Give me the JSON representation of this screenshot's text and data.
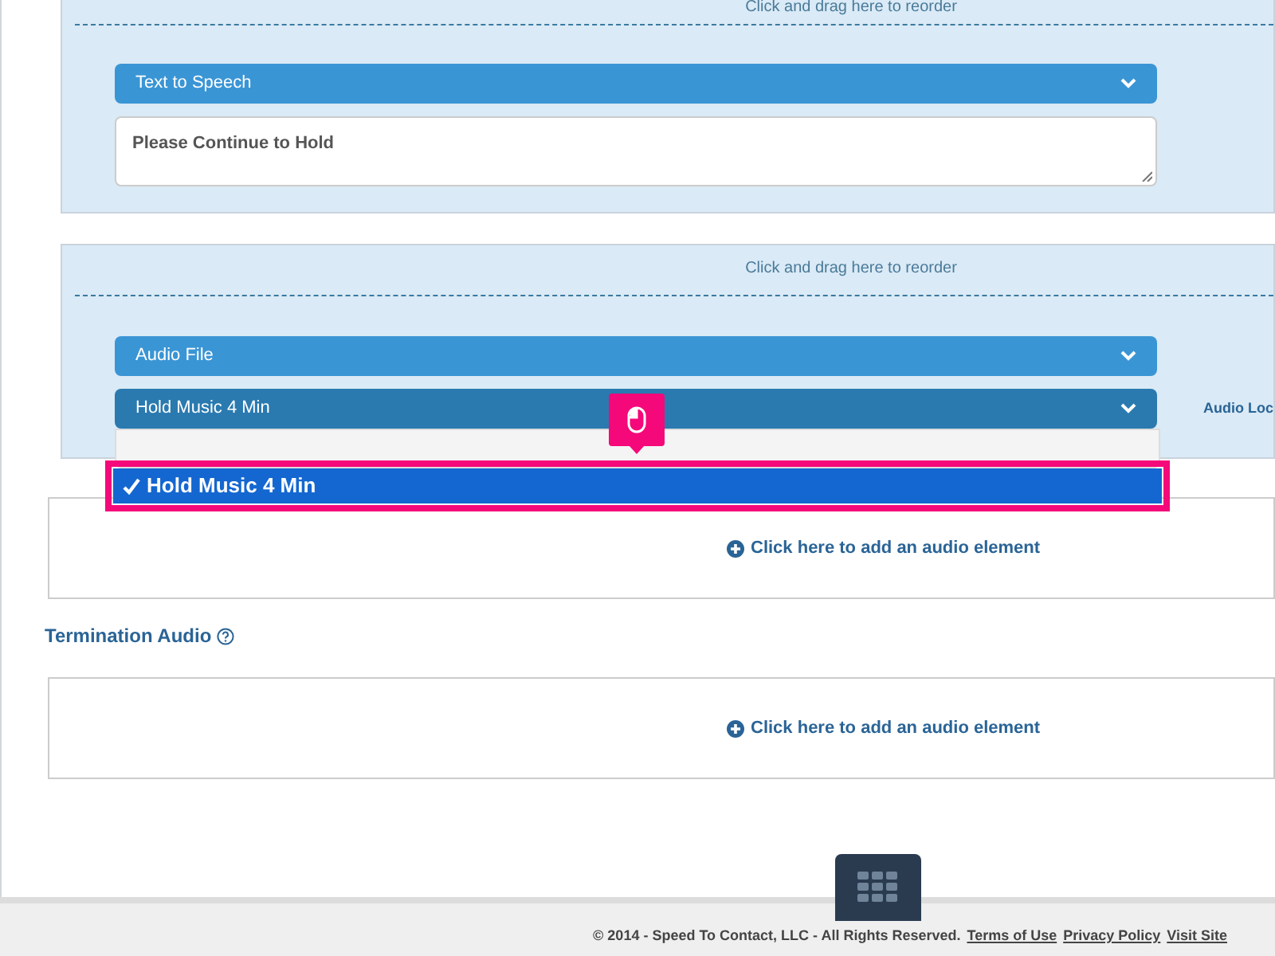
{
  "audio_elements": [
    {
      "drag_hint": "Click and drag here to reorder",
      "type_select": "Text to Speech",
      "kind": "tts",
      "text": "Please Continue to Hold"
    },
    {
      "drag_hint": "Click and drag here to reorder",
      "type_select": "Audio File",
      "kind": "file",
      "file_select": "Hold Music 4 Min",
      "side_label": "Audio Loc",
      "dropdown_options": [
        {
          "label": "Hold Music 4 Min",
          "selected": true
        }
      ]
    }
  ],
  "add_audio_1": "Click here to add an audio element",
  "termination": {
    "title": "Termination Audio",
    "add_audio": "Click here to add an audio element"
  },
  "footer": {
    "copyright": "© 2014 - Speed To Contact, LLC - All Rights Reserved.",
    "links": [
      "Terms of Use",
      "Privacy Policy",
      "Visit Site"
    ]
  }
}
